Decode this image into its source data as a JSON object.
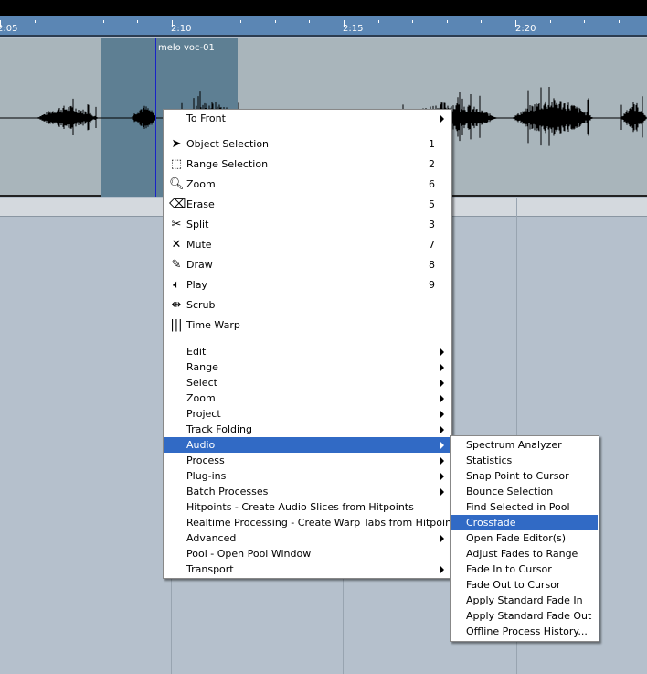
{
  "ruler": {
    "labels": [
      "2:05",
      "2:10",
      "2:15",
      "2:20"
    ]
  },
  "event": {
    "name": "melo voc-01"
  },
  "context_menu": {
    "to_front": "To Front",
    "tools": [
      {
        "label": "Object Selection",
        "key": "1",
        "icon": "arrow-pointer-icon"
      },
      {
        "label": "Range Selection",
        "key": "2",
        "icon": "range-selection-icon"
      },
      {
        "label": "Zoom",
        "key": "6",
        "icon": "magnifier-icon"
      },
      {
        "label": "Erase",
        "key": "5",
        "icon": "eraser-icon"
      },
      {
        "label": "Split",
        "key": "3",
        "icon": "scissors-icon"
      },
      {
        "label": "Mute",
        "key": "7",
        "icon": "x-mute-icon"
      },
      {
        "label": "Draw",
        "key": "8",
        "icon": "pencil-icon"
      },
      {
        "label": "Play",
        "key": "9",
        "icon": "speaker-icon"
      },
      {
        "label": "Scrub",
        "key": "",
        "icon": "scrub-icon"
      },
      {
        "label": "Time Warp",
        "key": "",
        "icon": "time-warp-icon"
      }
    ],
    "submenus": [
      {
        "label": "Edit",
        "arrow": true
      },
      {
        "label": "Range",
        "arrow": true
      },
      {
        "label": "Select",
        "arrow": true
      },
      {
        "label": "Zoom",
        "arrow": true
      },
      {
        "label": "Project",
        "arrow": true
      },
      {
        "label": "Track Folding",
        "arrow": true
      },
      {
        "label": "Audio",
        "arrow": true,
        "highlighted": true
      },
      {
        "label": "Process",
        "arrow": true
      },
      {
        "label": "Plug-ins",
        "arrow": true
      },
      {
        "label": "Batch Processes",
        "arrow": true
      },
      {
        "label": "Hitpoints - Create Audio Slices from Hitpoints",
        "arrow": false
      },
      {
        "label": "Realtime Processing - Create Warp Tabs from Hitpoints",
        "arrow": false
      },
      {
        "label": "Advanced",
        "arrow": true
      },
      {
        "label": "Pool - Open Pool Window",
        "arrow": false
      },
      {
        "label": "Transport",
        "arrow": true
      }
    ]
  },
  "audio_submenu": {
    "items": [
      {
        "label": "Spectrum Analyzer"
      },
      {
        "label": "Statistics"
      },
      {
        "label": "Snap Point to Cursor"
      },
      {
        "label": "Bounce Selection"
      },
      {
        "label": "Find Selected in Pool"
      },
      {
        "label": "Crossfade",
        "highlighted": true
      },
      {
        "label": "Open Fade Editor(s)"
      },
      {
        "label": "Adjust Fades to Range"
      },
      {
        "label": "Fade In to Cursor"
      },
      {
        "label": "Fade Out to Cursor"
      },
      {
        "label": "Apply Standard Fade In"
      },
      {
        "label": "Apply Standard Fade Out"
      },
      {
        "label": "Offline Process History..."
      }
    ]
  },
  "colors": {
    "highlight": "#316ac5",
    "ruler": "#5b86b4",
    "selection": "#5e7f93"
  }
}
